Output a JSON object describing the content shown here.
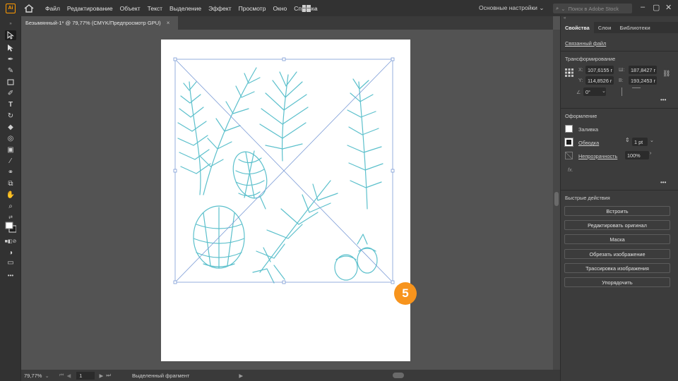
{
  "menubar": {
    "app_icon_label": "Ai",
    "items": [
      "Файл",
      "Редактирование",
      "Объект",
      "Текст",
      "Выделение",
      "Эффект",
      "Просмотр",
      "Окно",
      "Справка"
    ],
    "workspace": "Основные настройки",
    "search_placeholder": "Поиск в Adobe Stock"
  },
  "document": {
    "tab_title": "Безымянный-1* @ 79,77% (CMYK/Предпросмотр GPU)",
    "tab_close": "×"
  },
  "status": {
    "zoom": "79,77%",
    "page": "1",
    "selection": "Выделенный фрагмент"
  },
  "badge": {
    "number": "5",
    "color": "#f7941d"
  },
  "artwork": {
    "stroke_color": "#5cc0cc",
    "bbox_color": "#7b9bd6"
  },
  "panel": {
    "tabs": [
      "Свойства",
      "Слои",
      "Библиотеки"
    ],
    "linked_file": "Связанный файл",
    "transform": {
      "title": "Трансформирование",
      "x_label": "X:",
      "x_value": "107,6155 r",
      "y_label": "Y:",
      "y_value": "114,8526 r",
      "w_label": "Ш:",
      "w_value": "187,8427 r",
      "h_label": "В:",
      "h_value": "193,2453 r",
      "angle": "0°"
    },
    "appearance": {
      "title": "Оформление",
      "fill": "Заливка",
      "stroke": "Обводка",
      "stroke_value": "1 pt",
      "opacity": "Непрозрачность",
      "opacity_value": "100%",
      "fx": "fx."
    },
    "quick_actions": {
      "title": "Быстрые действия",
      "buttons": [
        "Встроить",
        "Редактировать оригинал",
        "Маска",
        "Обрезать изображение",
        "Трассировка изображения",
        "Упорядочить"
      ]
    },
    "more": "•••"
  }
}
